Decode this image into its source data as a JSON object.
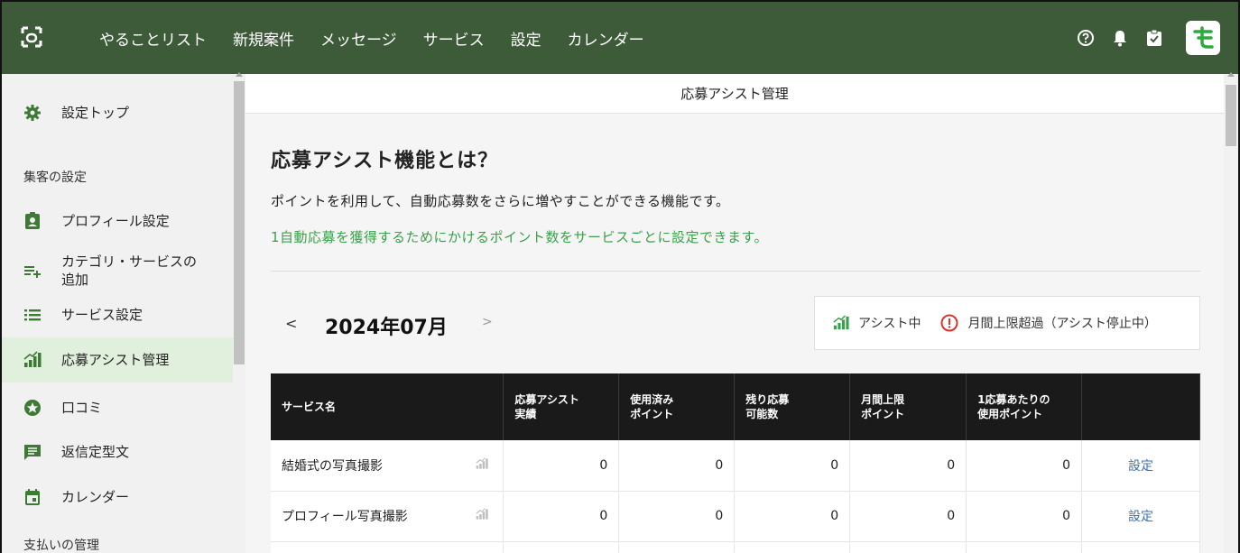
{
  "nav": {
    "items": [
      "やることリスト",
      "新規案件",
      "メッセージ",
      "サービス",
      "設定",
      "カレンダー"
    ]
  },
  "icons": {
    "logo": "app-logo-icon",
    "help": "help-icon",
    "bell": "bell-icon",
    "clipboard": "clipboard-check-icon",
    "brand": "brand-logo-icon"
  },
  "colors": {
    "topbar": "#3e5b39",
    "active_sidebar": "#e1efdd",
    "green_text": "#3aa14a",
    "link": "#3a73b8",
    "warning": "#d9342b"
  },
  "sidebar": {
    "top": "設定トップ",
    "section1": "集客の設定",
    "items": [
      {
        "label": "プロフィール設定",
        "icon": "profile-badge-icon"
      },
      {
        "label": "カテゴリ・サービスの追加",
        "icon": "add-list-icon"
      },
      {
        "label": "サービス設定",
        "icon": "list-icon"
      },
      {
        "label": "応募アシスト管理",
        "icon": "signal-bars-icon"
      },
      {
        "label": "口コミ",
        "icon": "star-icon"
      },
      {
        "label": "返信定型文",
        "icon": "message-icon"
      },
      {
        "label": "カレンダー",
        "icon": "calendar-icon"
      }
    ],
    "section2": "支払いの管理"
  },
  "page": {
    "header": "応募アシスト管理",
    "title": "応募アシスト機能とは？",
    "desc1": "ポイントを利用して、自動応募数をさらに増やすことができる機能です。",
    "desc2": "1自動応募を獲得するためにかけるポイント数をサービスごとに設定できます。",
    "month_prev": "<",
    "month": "2024年07月",
    "month_next": ">",
    "legend": {
      "assist": "アシスト中",
      "limit": "月間上限超過（アシスト停止中）"
    }
  },
  "table": {
    "headers": [
      "サービス名",
      "応募アシスト\n実績",
      "使用済み\nポイント",
      "残り応募\n可能数",
      "月間上限\nポイント",
      "1応募あたりの\n使用ポイント",
      ""
    ],
    "rows": [
      {
        "name": "結婚式の写真撮影",
        "values": [
          "0",
          "0",
          "0",
          "0",
          "0"
        ],
        "action": "設定"
      },
      {
        "name": "プロフィール写真撮影",
        "values": [
          "0",
          "0",
          "0",
          "0",
          "0"
        ],
        "action": "設定"
      }
    ]
  }
}
